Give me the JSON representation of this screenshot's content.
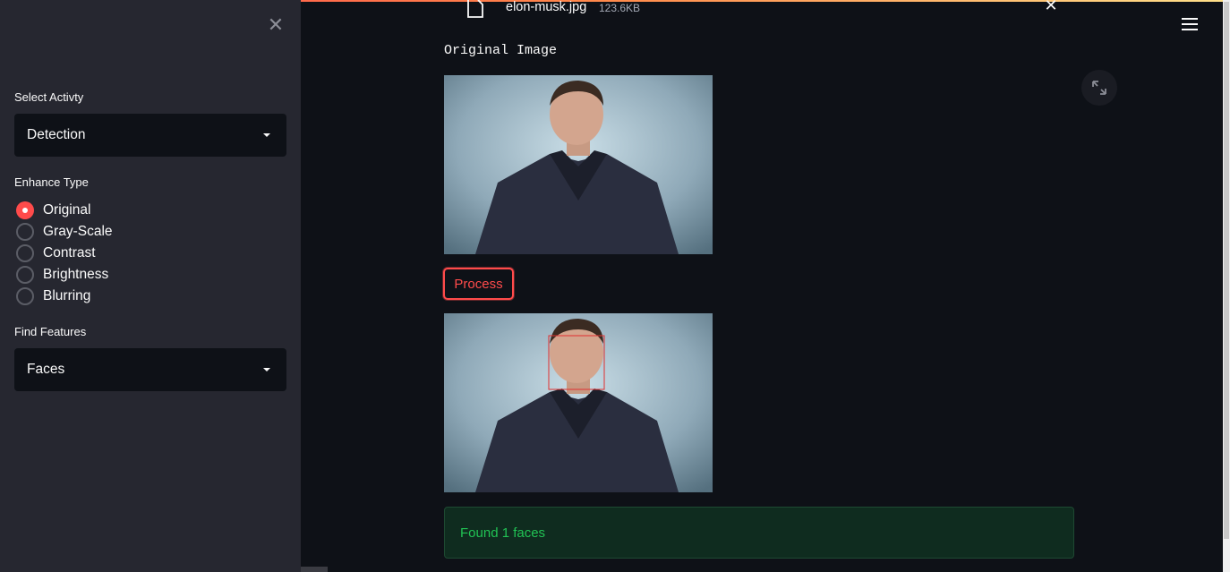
{
  "sidebar": {
    "close_icon": "close-icon",
    "select_activity_label": "Select Activty",
    "select_activity_value": "Detection",
    "enhance_type_label": "Enhance Type",
    "enhance_options": [
      "Original",
      "Gray-Scale",
      "Contrast",
      "Brightness",
      "Blurring"
    ],
    "enhance_selected": "Original",
    "find_features_label": "Find Features",
    "find_features_value": "Faces"
  },
  "uploader": {
    "file_name": "elon-musk.jpg",
    "file_size": "123.6KB"
  },
  "main": {
    "original_title": "Original Image",
    "process_label": "Process",
    "result_message": "Found 1 faces"
  },
  "colors": {
    "accent": "#ff4b4b",
    "success_text": "#21c354",
    "sidebar_bg": "#262730",
    "app_bg": "#0e1117"
  }
}
